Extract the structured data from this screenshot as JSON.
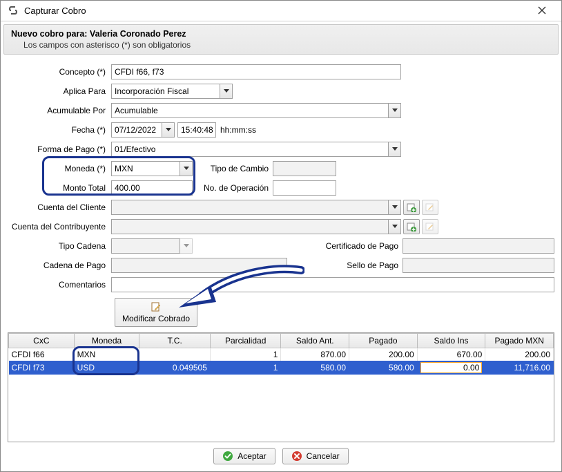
{
  "window": {
    "title": "Capturar Cobro"
  },
  "header": {
    "title_prefix": "Nuevo cobro para: ",
    "customer": "Valeria Coronado Perez",
    "subtitle": "Los campos con asterisco (*) son obligatorios"
  },
  "labels": {
    "concepto": "Concepto (*)",
    "aplica_para": "Aplica Para",
    "acumulable_por": "Acumulable Por",
    "fecha": "Fecha (*)",
    "hora_hint": "hh:mm:ss",
    "forma_pago": "Forma de Pago (*)",
    "moneda": "Moneda (*)",
    "tipo_cambio": "Tipo de Cambio",
    "monto_total": "Monto Total",
    "no_operacion": "No. de Operación",
    "cuenta_cliente": "Cuenta del Cliente",
    "cuenta_contribuyente": "Cuenta del Contribuyente",
    "tipo_cadena": "Tipo Cadena",
    "certificado_pago": "Certificado de Pago",
    "cadena_pago": "Cadena de Pago",
    "sello_pago": "Sello de Pago",
    "comentarios": "Comentarios",
    "modificar_cobrado": "Modificar Cobrado"
  },
  "values": {
    "concepto": "CFDI f66, f73",
    "aplica_para": "Incorporación Fiscal",
    "acumulable_por": "Acumulable",
    "fecha": "07/12/2022",
    "hora": "15:40:48",
    "forma_pago": "01/Efectivo",
    "moneda": "MXN",
    "tipo_cambio": "",
    "monto_total": "400.00",
    "no_operacion": "",
    "cuenta_cliente": "",
    "cuenta_contribuyente": "",
    "tipo_cadena": "",
    "certificado_pago": "",
    "cadena_pago": "",
    "sello_pago": "",
    "comentarios": ""
  },
  "table": {
    "columns": [
      "CxC",
      "Moneda",
      "T.C.",
      "Parcialidad",
      "Saldo Ant.",
      "Pagado",
      "Saldo Ins",
      "Pagado MXN"
    ],
    "rows": [
      {
        "cxc": "CFDI f66",
        "moneda": "MXN",
        "tc": "",
        "parcialidad": "1",
        "saldo_ant": "870.00",
        "pagado": "200.00",
        "saldo_ins": "670.00",
        "pagado_mxn": "200.00",
        "selected": false
      },
      {
        "cxc": "CFDI f73",
        "moneda": "USD",
        "tc": "0.049505",
        "parcialidad": "1",
        "saldo_ant": "580.00",
        "pagado": "580.00",
        "saldo_ins": "0.00",
        "pagado_mxn": "11,716.00",
        "selected": true
      }
    ]
  },
  "footer": {
    "ok": "Aceptar",
    "cancel": "Cancelar"
  },
  "colors": {
    "highlight_border": "#19338f",
    "selection_bg": "#2f5fce"
  }
}
